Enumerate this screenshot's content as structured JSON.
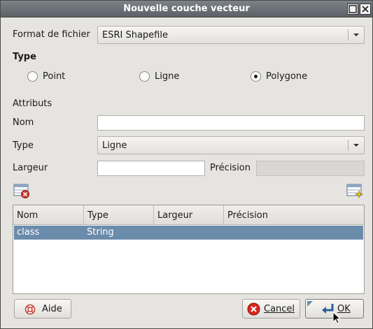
{
  "window": {
    "title": "Nouvelle couche vecteur"
  },
  "file_format": {
    "label": "Format de fichier",
    "value": "ESRI Shapefile"
  },
  "type_section": {
    "heading": "Type",
    "options": [
      {
        "label": "Point",
        "selected": false
      },
      {
        "label": "Ligne",
        "selected": false
      },
      {
        "label": "Polygone",
        "selected": true
      }
    ]
  },
  "attributes": {
    "heading": "Attributs",
    "name_label": "Nom",
    "name_value": "",
    "type_label": "Type",
    "type_value": "Ligne",
    "width_label": "Largeur",
    "width_value": "",
    "precision_label": "Précision",
    "precision_value": ""
  },
  "table": {
    "columns": [
      "Nom",
      "Type",
      "Largeur",
      "Précision"
    ],
    "rows": [
      {
        "nom": "class",
        "type": "String",
        "largeur": "",
        "precision": ""
      }
    ]
  },
  "buttons": {
    "help": "Aide",
    "cancel": "Cancel",
    "ok": "OK"
  },
  "icons": {
    "remove_attribute": "table-delete-icon",
    "add_attribute": "table-add-icon",
    "help": "lifebuoy-icon",
    "cancel": "cancel-icon",
    "ok": "enter-arrow-icon"
  },
  "colors": {
    "selection": "#6b8bab",
    "titlebar": "#6a6e75"
  }
}
